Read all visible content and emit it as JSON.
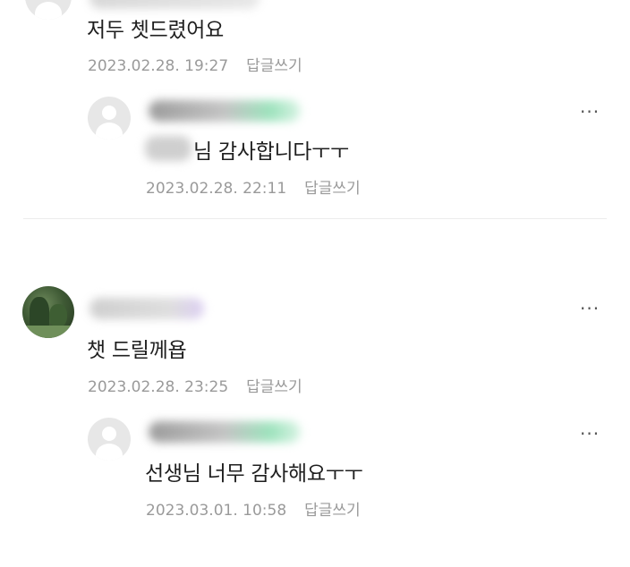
{
  "colors": {
    "text_primary": "#1f1f1f",
    "text_meta": "#9a9a9a",
    "divider": "#ececec"
  },
  "icons": {
    "more": "more-horizontal-icon",
    "default_avatar": "default-profile-icon"
  },
  "thread1": {
    "comment": {
      "text": "저두 쳇드렸어요",
      "timestamp": "2023.02.28. 19:27",
      "reply_label": "답글쓰기"
    },
    "reply": {
      "text_suffix": "님 감사합니다ㅜㅜ",
      "timestamp": "2023.02.28. 22:11",
      "reply_label": "답글쓰기",
      "more_label": "···"
    }
  },
  "thread2": {
    "comment": {
      "text": "챗 드릴께욥",
      "timestamp": "2023.02.28. 23:25",
      "reply_label": "답글쓰기",
      "more_label": "···"
    },
    "reply": {
      "text": "선생님 너무 감사해요ㅜㅜ",
      "timestamp": "2023.03.01. 10:58",
      "reply_label": "답글쓰기",
      "more_label": "···"
    }
  }
}
